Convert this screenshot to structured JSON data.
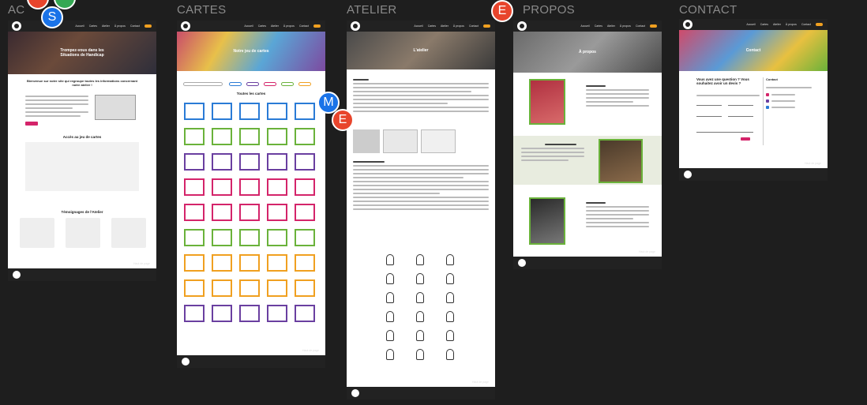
{
  "frames": {
    "accueil": {
      "label": "AC"
    },
    "cartes": {
      "label": "CARTES"
    },
    "atelier": {
      "label": "ATELIER"
    },
    "apropos": {
      "label": "PROPOS"
    },
    "contact": {
      "label": "CONTACT"
    }
  },
  "collaborators": [
    {
      "initial": "S",
      "color": "#1a73e8"
    },
    {
      "initial": "M",
      "color": "#1a73e8"
    },
    {
      "initial": "E",
      "color": "#e8452c"
    },
    {
      "initial": "E",
      "color": "#e8452c"
    }
  ],
  "accueil": {
    "nav": [
      "Accueil",
      "Cartes",
      "Atelier",
      "À propos",
      "Contact"
    ],
    "hero_title": "Trompez-vous dans les Situations de Handicap",
    "intro_title": "Bienvenue sur notre site qui regroupe toutes les informations concernant notre atelier !",
    "cards_title": "Accès au jeu de cartes",
    "testimonials_title": "Témoignages de l'Atelier",
    "up": "Haut de page"
  },
  "cartes": {
    "hero_title": "Notre jeu de cartes",
    "section_title": "Toutes les cartes",
    "up": "Haut de page"
  },
  "atelier": {
    "hero_title": "L'atelier",
    "up": "Haut de page"
  },
  "apropos": {
    "hero_title": "À propos",
    "up": "Haut de page"
  },
  "contact": {
    "hero_title": "Contact",
    "question": "Vous avez une question ? Vous souhaitez avoir un devis ?",
    "side_title": "Contact",
    "up": "Haut de page"
  },
  "colors": {
    "blue": "#2a7bd6",
    "green": "#6ab23a",
    "purple": "#6a3fa0",
    "pink": "#d4246a",
    "orange": "#f0a020",
    "red": "#d4246a",
    "accent": "#d4246a"
  }
}
